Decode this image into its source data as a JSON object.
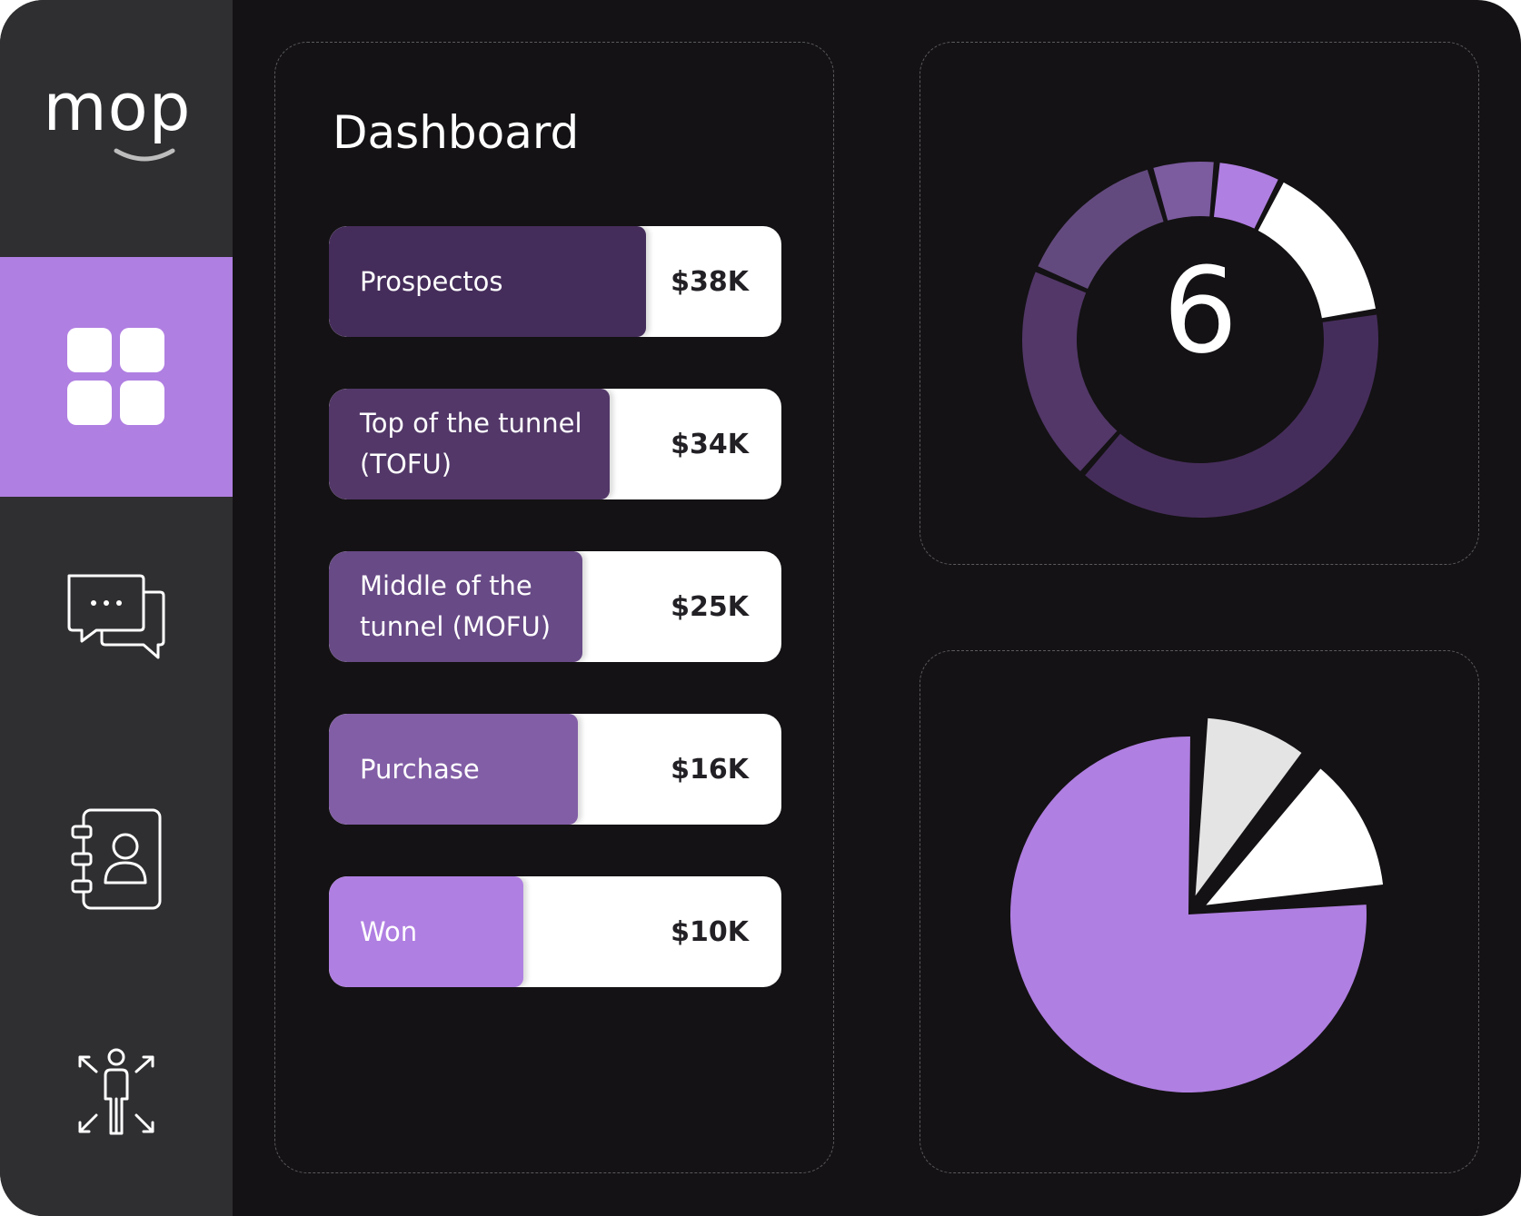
{
  "brand": {
    "logo_text": "mop"
  },
  "sidebar": {
    "items": [
      {
        "id": "dashboard",
        "icon": "dashboard-grid-icon",
        "active": true
      },
      {
        "id": "chats",
        "icon": "chat-bubbles-icon",
        "active": false
      },
      {
        "id": "contacts",
        "icon": "contact-book-icon",
        "active": false
      },
      {
        "id": "people",
        "icon": "person-arrows-icon",
        "active": false
      }
    ]
  },
  "main": {
    "title": "Dashboard",
    "funnel": [
      {
        "label": "Prospectos",
        "value": "$38K",
        "fill_fraction": 0.7,
        "color": "#452d5b"
      },
      {
        "label": "Top of the tunnel\n(TOFU)",
        "value": "$34K",
        "fill_fraction": 0.62,
        "color": "#523768"
      },
      {
        "label": "Middle of the\ntunnel (MOFU)",
        "value": "$25K",
        "fill_fraction": 0.56,
        "color": "#684a86"
      },
      {
        "label": "Purchase",
        "value": "$16K",
        "fill_fraction": 0.55,
        "color": "#825ea6"
      },
      {
        "label": "Won",
        "value": "$10K",
        "fill_fraction": 0.43,
        "color": "#b07fe2"
      }
    ]
  },
  "donut": {
    "center_value": "6",
    "segments": [
      {
        "fraction": 0.39,
        "color": "#452d5b"
      },
      {
        "fraction": 0.2,
        "color": "#523768"
      },
      {
        "fraction": 0.14,
        "color": "#634a7e"
      },
      {
        "fraction": 0.06,
        "color": "#7c5b9f"
      },
      {
        "fraction": 0.06,
        "color": "#b07fe2"
      },
      {
        "fraction": 0.15,
        "color": "#ffffff"
      }
    ]
  },
  "pie": {
    "segments": [
      {
        "fraction": 0.1,
        "color": "#e4e4e4"
      },
      {
        "fraction": 0.13,
        "color": "#ffffff"
      },
      {
        "fraction": 0.77,
        "color": "#b07fe2"
      }
    ]
  },
  "colors": {
    "background": "#141214",
    "sidebar": "#2f2e30",
    "accent": "#b07fe2"
  }
}
